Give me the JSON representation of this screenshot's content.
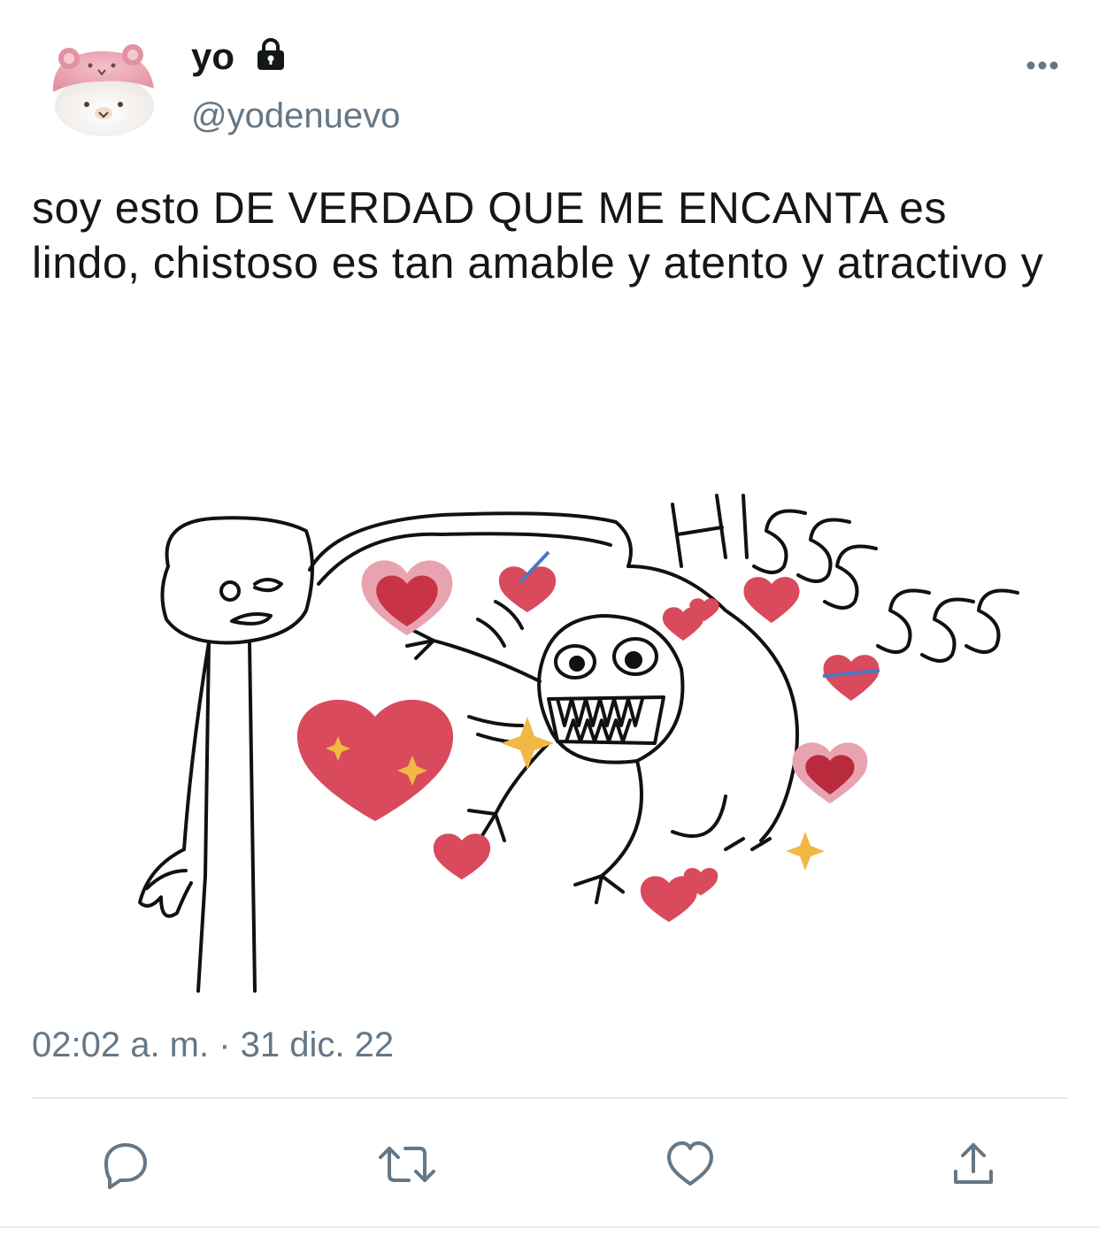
{
  "author": {
    "display_name": "yo",
    "handle": "@yodenuevo",
    "avatar_icon": "bear-hat-plush-avatar",
    "locked_icon": "lock-icon"
  },
  "tweet": {
    "text": "soy esto DE VERDAD QUE ME ENCANTA es lindo, chistoso es tan amable y atento y atractivo y",
    "timestamp": "02:02 a. m. · 31 dic. 22"
  },
  "media": {
    "sound_effect_text": "HISSSSSS",
    "icon": "meme-drawing"
  },
  "actions": [
    {
      "name": "reply",
      "icon": "speech-bubble-icon"
    },
    {
      "name": "retweet",
      "icon": "retweet-icon"
    },
    {
      "name": "like",
      "icon": "heart-icon"
    },
    {
      "name": "share",
      "icon": "share-icon"
    }
  ],
  "colors": {
    "text_primary": "#14171a",
    "text_secondary": "#657786",
    "icon": "#657786",
    "divider": "#e1e8ed",
    "avatar_pink": "#e9a2b0",
    "heart_red": "#d94a5c"
  }
}
